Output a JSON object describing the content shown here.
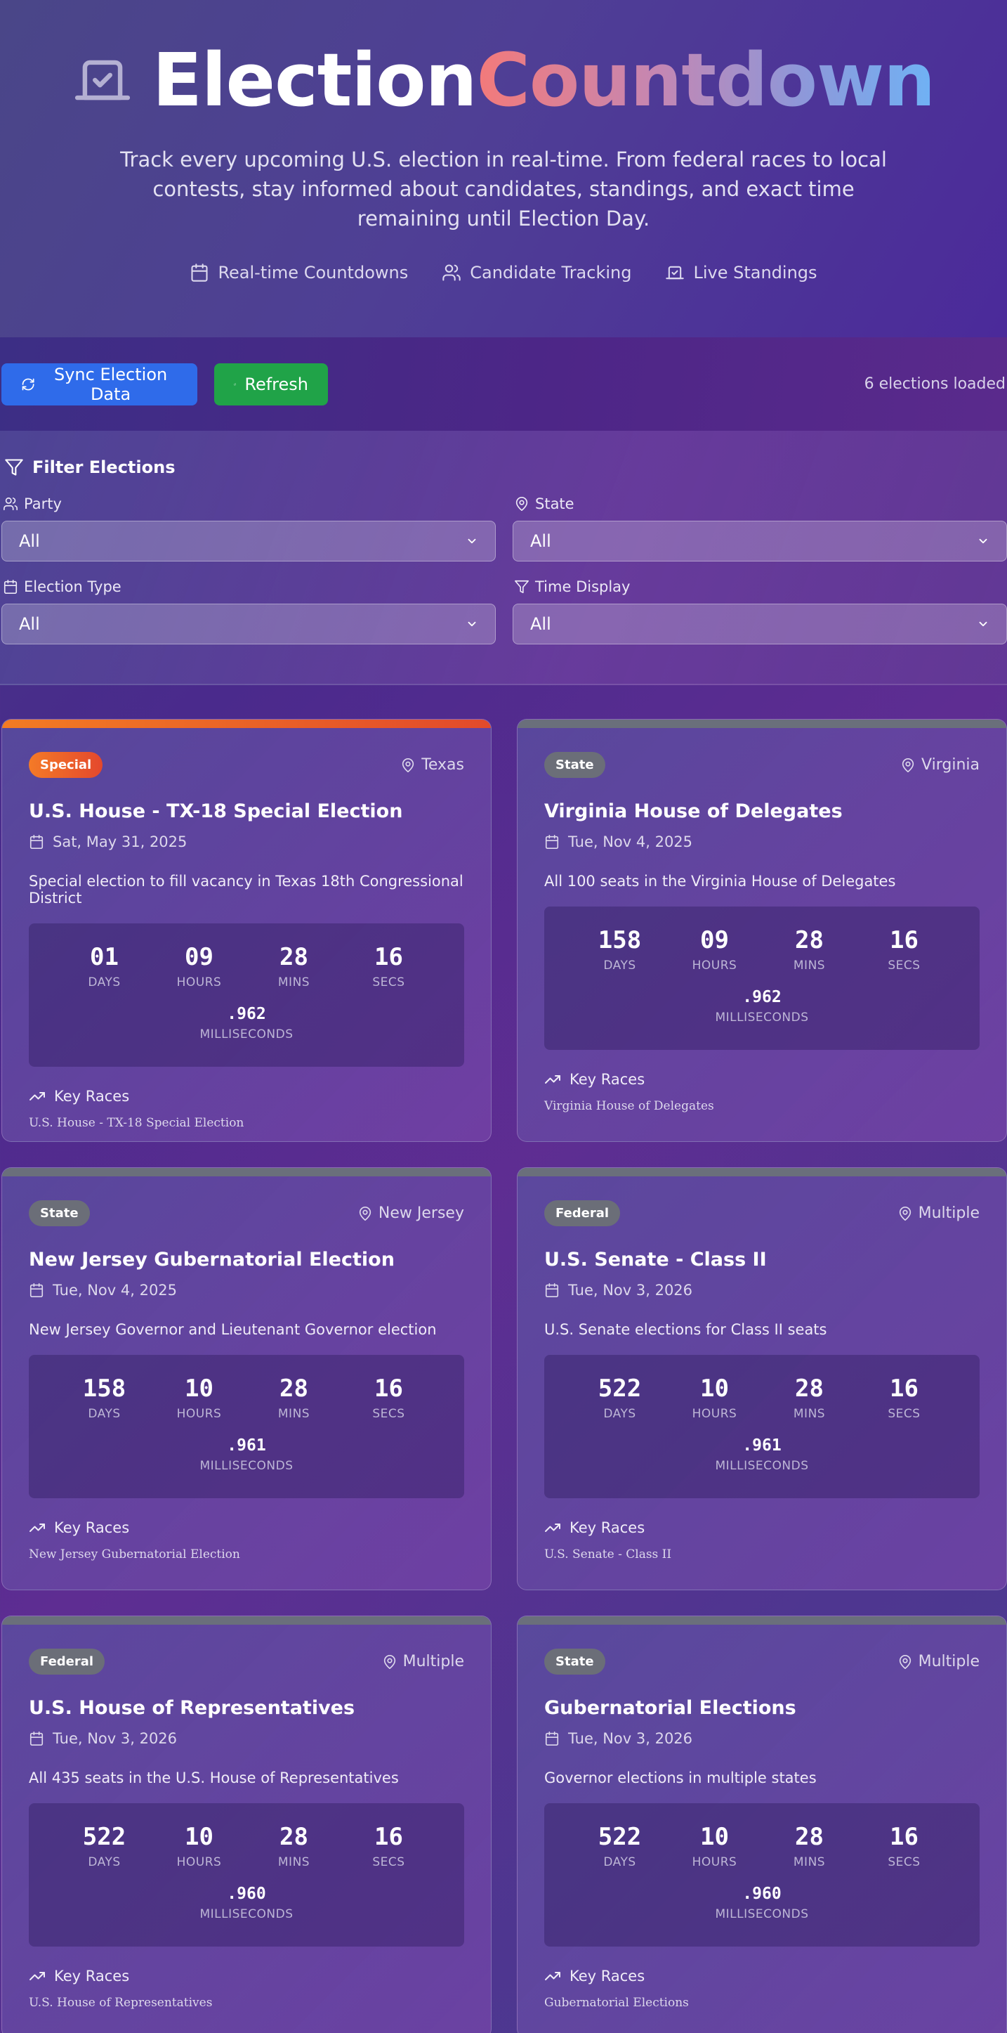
{
  "header": {
    "title_part1": "Election",
    "title_part2": "Countdown",
    "subtitle": "Track every upcoming U.S. election in real-time. From federal races to local contests, stay informed about candidates, standings, and exact time remaining until Election Day.",
    "features": [
      {
        "label": "Real-time Countdowns",
        "icon": "calendar-icon"
      },
      {
        "label": "Candidate Tracking",
        "icon": "users-icon"
      },
      {
        "label": "Live Standings",
        "icon": "vote-icon"
      }
    ]
  },
  "toolbar": {
    "sync_label": "Sync Election Data",
    "refresh_label": "Refresh",
    "count_text": "6 elections loaded",
    "sync_color": "#2f6bea",
    "refresh_color": "#20a348"
  },
  "filters": {
    "title": "Filter Elections",
    "party": {
      "label": "Party",
      "value": "All"
    },
    "state": {
      "label": "State",
      "value": "All"
    },
    "election_type": {
      "label": "Election Type",
      "value": "All"
    },
    "time_display": {
      "label": "Time Display",
      "value": "All"
    }
  },
  "countdown_labels": {
    "days": "DAYS",
    "hours": "HOURS",
    "mins": "MINS",
    "secs": "SECS",
    "ms": "MILLISECONDS"
  },
  "key_races_label": "Key Races",
  "cards": [
    {
      "badge": "Special",
      "location": "Texas",
      "title": "U.S. House - TX-18 Special Election",
      "date": "Sat, May 31, 2025",
      "description": "Special election to fill vacancy in Texas 18th Congressional District",
      "days": "01",
      "hours": "09",
      "mins": "28",
      "secs": "16",
      "ms": ".962",
      "key_race": "U.S. House - TX-18 Special Election"
    },
    {
      "badge": "State",
      "location": "Virginia",
      "title": "Virginia House of Delegates",
      "date": "Tue, Nov 4, 2025",
      "description": "All 100 seats in the Virginia House of Delegates",
      "days": "158",
      "hours": "09",
      "mins": "28",
      "secs": "16",
      "ms": ".962",
      "key_race": "Virginia House of Delegates"
    },
    {
      "badge": "State",
      "location": "New Jersey",
      "title": "New Jersey Gubernatorial Election",
      "date": "Tue, Nov 4, 2025",
      "description": "New Jersey Governor and Lieutenant Governor election",
      "days": "158",
      "hours": "10",
      "mins": "28",
      "secs": "16",
      "ms": ".961",
      "key_race": "New Jersey Gubernatorial Election"
    },
    {
      "badge": "Federal",
      "location": "Multiple",
      "title": "U.S. Senate - Class II",
      "date": "Tue, Nov 3, 2026",
      "description": "U.S. Senate elections for Class II seats",
      "days": "522",
      "hours": "10",
      "mins": "28",
      "secs": "16",
      "ms": ".961",
      "key_race": "U.S. Senate - Class II"
    },
    {
      "badge": "Federal",
      "location": "Multiple",
      "title": "U.S. House of Representatives",
      "date": "Tue, Nov 3, 2026",
      "description": "All 435 seats in the U.S. House of Representatives",
      "days": "522",
      "hours": "10",
      "mins": "28",
      "secs": "16",
      "ms": ".960",
      "key_race": "U.S. House of Representatives"
    },
    {
      "badge": "State",
      "location": "Multiple",
      "title": "Gubernatorial Elections",
      "date": "Tue, Nov 3, 2026",
      "description": "Governor elections in multiple states",
      "days": "522",
      "hours": "10",
      "mins": "28",
      "secs": "16",
      "ms": ".960",
      "key_race": "Gubernatorial Elections"
    }
  ]
}
